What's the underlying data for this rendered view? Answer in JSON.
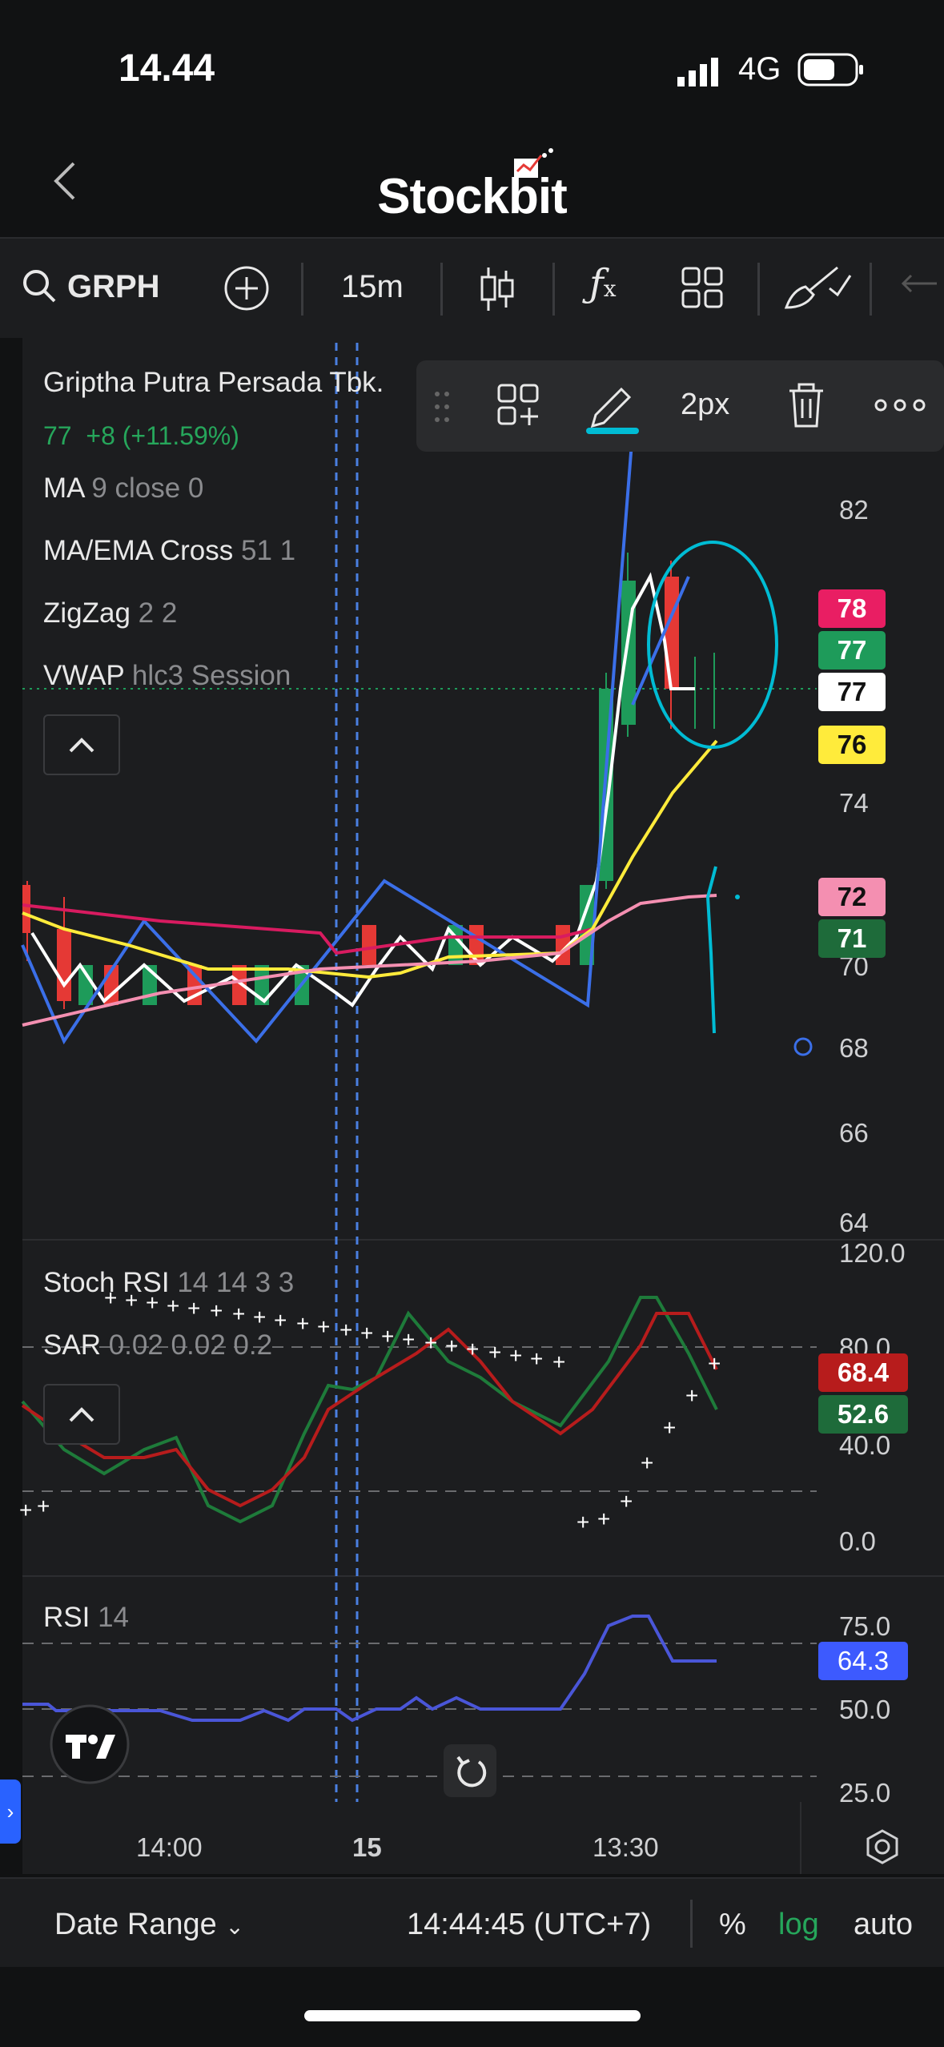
{
  "status": {
    "time": "14.44",
    "network": "4G"
  },
  "app": {
    "brand": "Stockbit"
  },
  "toolbar": {
    "symbol": "GRPH",
    "interval": "15m"
  },
  "drawing_toolbar": {
    "stroke_width": "2px"
  },
  "legend": {
    "company": "Griptha Putra Persada Tbk.",
    "price": "77",
    "change": "+8 (+11.59%)",
    "indicators": [
      {
        "name": "MA",
        "params": "9 close 0"
      },
      {
        "name": "MA/EMA Cross",
        "params": "51 1"
      },
      {
        "name": "ZigZag",
        "params": "2 2"
      },
      {
        "name": "VWAP",
        "params": "hlc3 Session"
      }
    ]
  },
  "price_axis": [
    "82",
    "74",
    "70",
    "68",
    "66",
    "64"
  ],
  "price_badges": [
    {
      "value": "78",
      "bg": "#e91e63",
      "fg": "#ffffff"
    },
    {
      "value": "77",
      "bg": "#1e9b5a",
      "fg": "#ffffff"
    },
    {
      "value": "77",
      "bg": "#ffffff",
      "fg": "#111111"
    },
    {
      "value": "76",
      "bg": "#ffeb3b",
      "fg": "#111111"
    },
    {
      "value": "72",
      "bg": "#f48fb1",
      "fg": "#111111"
    },
    {
      "value": "71",
      "bg": "#1e6b3a",
      "fg": "#ffffff"
    }
  ],
  "stoch_pane": {
    "label1": {
      "name": "Stoch RSI",
      "params": "14 14 3 3"
    },
    "label2": {
      "name": "SAR",
      "params": "0.02 0.02 0.2"
    },
    "axis": [
      "120.0",
      "80.0",
      "40.0",
      "0.0"
    ],
    "badges": [
      {
        "value": "68.4",
        "bg": "#b71c1c"
      },
      {
        "value": "52.6",
        "bg": "#1e6b3a"
      }
    ]
  },
  "rsi_pane": {
    "label": {
      "name": "RSI",
      "params": "14"
    },
    "axis": [
      "75.0",
      "50.0",
      "25.0"
    ],
    "badge": {
      "value": "64.3",
      "bg": "#3d5afe"
    }
  },
  "time_axis": [
    "14:00",
    "15",
    "13:30"
  ],
  "footer": {
    "date_range": "Date Range",
    "clock": "14:44:45 (UTC+7)",
    "percent": "%",
    "log": "log",
    "auto": "auto"
  },
  "colors": {
    "up": "#1e9b5a",
    "down": "#e53935",
    "accent": "#00bcd4",
    "log_active": "#26a65b"
  }
}
